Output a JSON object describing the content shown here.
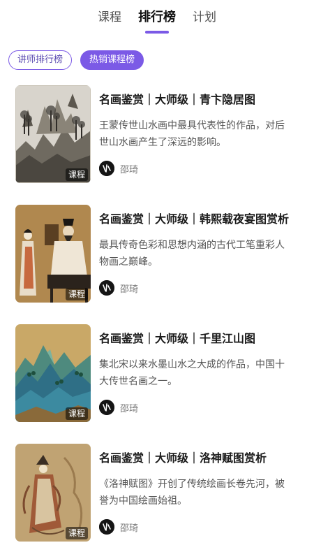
{
  "tabs": [
    {
      "label": "课程"
    },
    {
      "label": "排行榜"
    },
    {
      "label": "计划"
    }
  ],
  "filters": [
    {
      "label": "讲师排行榜"
    },
    {
      "label": "热销课程榜"
    }
  ],
  "items": [
    {
      "title": "名画鉴赏｜大师级｜青卞隐居图",
      "desc": "王蒙传世山水画中最具代表性的作品，对后世山水画产生了深远的影响。",
      "badge": "课程",
      "author": "邵琦"
    },
    {
      "title": "名画鉴赏｜大师级｜韩熙载夜宴图赏析",
      "desc": "最具传奇色彩和思想内涵的古代工笔重彩人物画之巅峰。",
      "badge": "课程",
      "author": "邵琦"
    },
    {
      "title": "名画鉴赏｜大师级｜千里江山图",
      "desc": "集北宋以来水墨山水之大成的作品，中国十大传世名画之一。",
      "badge": "课程",
      "author": "邵琦"
    },
    {
      "title": "名画鉴赏｜大师级｜洛神赋图赏析",
      "desc": "《洛神赋图》开创了传统绘画长卷先河，被誉为中国绘画始祖。",
      "badge": "课程",
      "author": "邵琦"
    }
  ],
  "colors": {
    "accent": "#7b5ae6"
  }
}
